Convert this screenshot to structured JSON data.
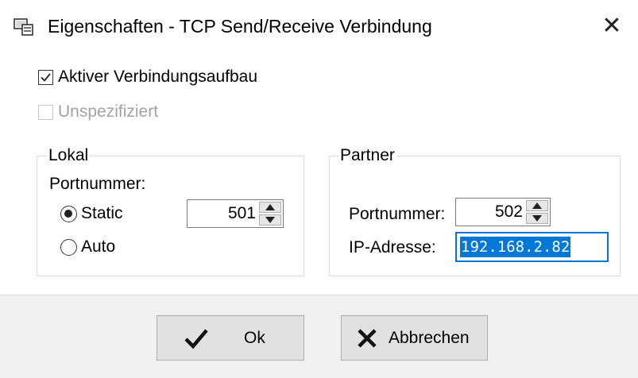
{
  "window": {
    "title": "Eigenschaften - TCP Send/Receive Verbindung",
    "close_glyph": "✕"
  },
  "options": {
    "active_connection": {
      "label": "Aktiver Verbindungsaufbau",
      "checked": true
    },
    "unspecified": {
      "label": "Unspezifiziert",
      "checked": false,
      "enabled": false
    }
  },
  "local": {
    "legend": "Lokal",
    "port_label": "Portnummer:",
    "static_label": "Static",
    "auto_label": "Auto",
    "mode": "Static",
    "port_value": "501"
  },
  "partner": {
    "legend": "Partner",
    "port_label": "Portnummer:",
    "port_value": "502",
    "ip_label": "IP-Adresse:",
    "ip_value": "192.168.2.82"
  },
  "buttons": {
    "ok_label": "Ok",
    "cancel_label": "Abbrechen"
  },
  "colors": {
    "selection": "#0078d7",
    "footer": "#f0f0f0",
    "button_face": "#e1e1e1"
  }
}
